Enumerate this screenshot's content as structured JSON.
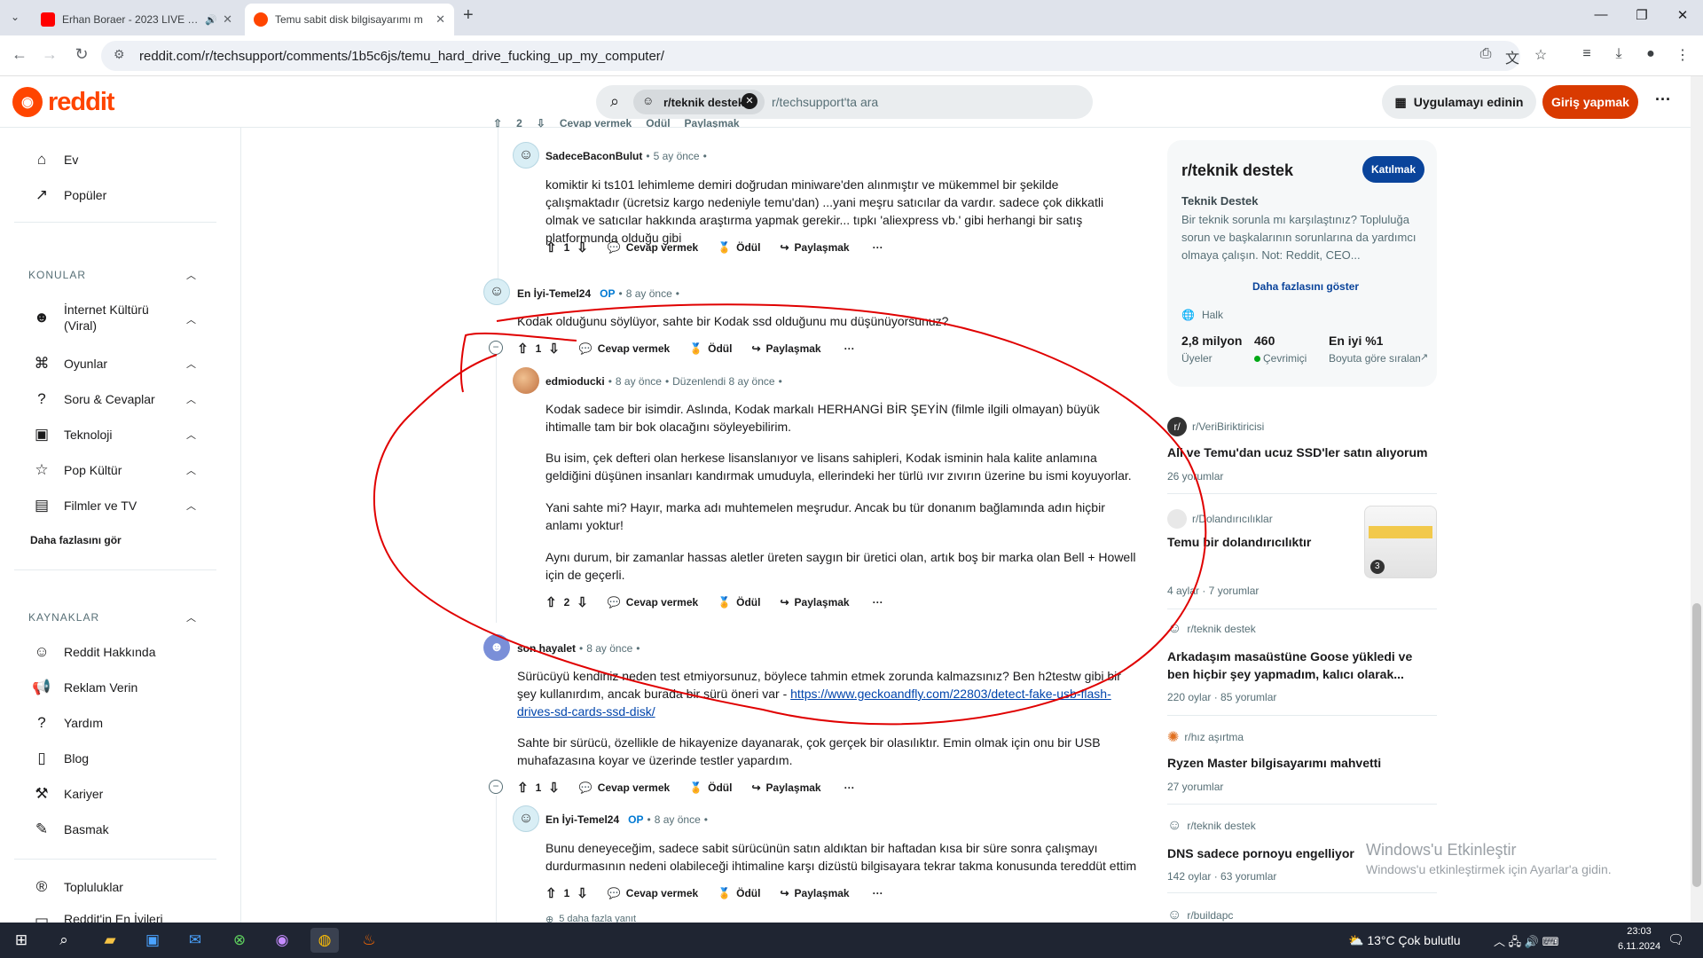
{
  "browser": {
    "tabs": [
      {
        "title": "Erhan Boraer - 2023 LIVE SE",
        "active": false
      },
      {
        "title": "Temu sabit disk bilgisayarımı m",
        "active": true
      }
    ],
    "url": "reddit.com/r/techsupport/comments/1b5c6js/temu_hard_drive_fucking_up_my_computer/"
  },
  "header": {
    "logo": "reddit",
    "search_chip": "r/teknik destek",
    "search_placeholder": "r/techsupport'ta ara",
    "get_app": "Uygulamayı edinin",
    "login": "Giriş yapmak"
  },
  "leftnav": {
    "top": [
      {
        "label": "Ev",
        "icon": "home-icon"
      },
      {
        "label": "Popüler",
        "icon": "popular-icon"
      }
    ],
    "topics_header": "KONULAR",
    "topics": [
      {
        "label": "İnternet Kültürü (Viral)",
        "icon": "meme-icon"
      },
      {
        "label": "Oyunlar",
        "icon": "gamepad-icon"
      },
      {
        "label": "Soru & Cevaplar",
        "icon": "question-icon"
      },
      {
        "label": "Teknoloji",
        "icon": "chip-icon"
      },
      {
        "label": "Pop Kültür",
        "icon": "star-icon"
      },
      {
        "label": "Filmler ve TV",
        "icon": "clapper-icon"
      }
    ],
    "see_more": "Daha fazlasını gör",
    "resources_header": "KAYNAKLAR",
    "resources": [
      {
        "label": "Reddit Hakkında",
        "icon": "reddit-icon"
      },
      {
        "label": "Reklam Verin",
        "icon": "megaphone-icon"
      },
      {
        "label": "Yardım",
        "icon": "help-icon"
      },
      {
        "label": "Blog",
        "icon": "book-icon"
      },
      {
        "label": "Kariyer",
        "icon": "wrench-icon"
      },
      {
        "label": "Basmak",
        "icon": "pen-icon"
      }
    ],
    "communities": "Topluluklar",
    "best_of": "Reddit'in En İyileri"
  },
  "comments": {
    "top_partial_actions": {
      "vote": "2",
      "reply": "Cevap vermek",
      "award": "Ödül",
      "share": "Paylaşmak"
    },
    "c1": {
      "user": "SadeceBaconBulut",
      "time": "5 ay önce",
      "text": "komiktir ki ts101 lehimleme demiri doğrudan miniware'den alınmıştır ve mükemmel bir şekilde çalışmaktadır (ücretsiz kargo nedeniyle temu'dan) ...yani meşru satıcılar da vardır. sadece çok dikkatli olmak ve satıcılar hakkında araştırma yapmak gerekir... tıpkı 'aliexpress vb.' gibi herhangi bir satış platformunda olduğu gibi",
      "votes": "1"
    },
    "c2": {
      "user": "En İyi-Temel24",
      "op": "OP",
      "time": "8 ay önce",
      "text": "Kodak olduğunu söylüyor, sahte bir Kodak ssd olduğunu mu düşünüyorsunuz?",
      "votes": "1"
    },
    "c3": {
      "user": "edmioducki",
      "time": "8 ay önce",
      "edited": "Düzenlendi 8 ay önce",
      "p1": "Kodak sadece bir isimdir. Aslında, Kodak markalı HERHANGİ BİR ŞEYİN (filmle ilgili olmayan) büyük ihtimalle tam bir bok olacağını söyleyebilirim.",
      "p2": "Bu isim, çek defteri olan herkese lisanslanıyor ve lisans sahipleri, Kodak isminin hala kalite anlamına geldiğini düşünen insanları kandırmak umuduyla, ellerindeki her türlü ıvır zıvırın üzerine bu ismi koyuyorlar.",
      "p3": "Yani sahte mi? Hayır, marka adı muhtemelen meşrudur. Ancak bu tür donanım bağlamında adın hiçbir anlamı yoktur!",
      "p4": "Aynı durum, bir zamanlar hassas aletler üreten saygın bir üretici olan, artık boş bir marka olan Bell + Howell için de geçerli.",
      "votes": "2"
    },
    "c4": {
      "user": "son hayalet",
      "time": "8 ay önce",
      "p1": "Sürücüyü kendiniz neden test etmiyorsunuz, böylece tahmin etmek zorunda kalmazsınız? Ben h2testw gibi bir şey kullanırdım, ancak burada bir sürü öneri var - ",
      "link": "https://www.geckoandfly.com/22803/detect-fake-usb-flash-drives-sd-cards-ssd-disk/",
      "p2": "Sahte bir sürücü, özellikle de hikayenize dayanarak, çok gerçek bir olasılıktır. Emin olmak için onu bir USB muhafazasına koyar ve üzerinde testler yapardım.",
      "votes": "1"
    },
    "c5": {
      "user": "En İyi-Temel24",
      "op": "OP",
      "time": "8 ay önce",
      "text": "Bunu deneyeceğim, sadece sabit sürücünün satın aldıktan bir haftadan kısa bir süre sonra çalışmayı durdurmasının nedeni olabileceği ihtimaline karşı dizüstü bilgisayara tekrar takma konusunda tereddüt ettim",
      "votes": "1",
      "more_replies": "5 daha fazla yanıt"
    },
    "labels": {
      "reply": "Cevap vermek",
      "award": "Ödül",
      "share": "Paylaşmak",
      "sep": "•"
    }
  },
  "sidebar": {
    "sub_name": "r/teknik destek",
    "join": "Katılmak",
    "title": "Teknik Destek",
    "description": "Bir teknik sorunla mı karşılaştınız? Topluluğa sorun ve başkalarının sorunlarına da yardımcı olmaya çalışın. Not: Reddit, CEO...",
    "show_more": "Daha fazlasını göster",
    "visibility": "Halk",
    "stats": [
      {
        "value": "2,8 milyon",
        "label": "Üyeler"
      },
      {
        "value": "460",
        "label": "Çevrimiçi"
      },
      {
        "value": "En iyi %1",
        "label": "Boyuta göre sıralama"
      }
    ],
    "related": [
      {
        "sub": "r/VeriBiriktiricisi",
        "title": "Ali ve Temu'dan ucuz SSD'ler satın alıyorum",
        "meta": "26 yorumlar"
      },
      {
        "sub": "r/Dolandırıcılıklar",
        "title": "Temu bir dolandırıcılıktır",
        "meta": "4 aylar · 7 yorumlar",
        "thumb_badge": "3"
      },
      {
        "sub": "r/teknik destek",
        "title": "Arkadaşım masaüstüne Goose yükledi ve ben hiçbir şey yapmadım, kalıcı olarak...",
        "meta": "220 oylar · 85 yorumlar"
      },
      {
        "sub": "r/hız aşırtma",
        "title": "Ryzen Master bilgisayarımı mahvetti",
        "meta": "27 yorumlar"
      },
      {
        "sub": "r/teknik destek",
        "title": "DNS sadece pornoyu engelliyor",
        "meta": "142 oylar · 63 yorumlar"
      },
      {
        "sub": "r/buildapc",
        "title": "",
        "meta": ""
      }
    ]
  },
  "watermark": {
    "line1": "Windows'u Etkinleştir",
    "line2": "Windows'u etkinleştirmek için Ayarlar'a gidin."
  },
  "taskbar": {
    "weather": "13°C  Çok bulutlu",
    "time": "23:03",
    "date": "6.11.2024"
  },
  "colors": {
    "accent": "#ff4500",
    "login": "#d93a00",
    "join": "#0a449b",
    "annotation": "#e00000"
  }
}
